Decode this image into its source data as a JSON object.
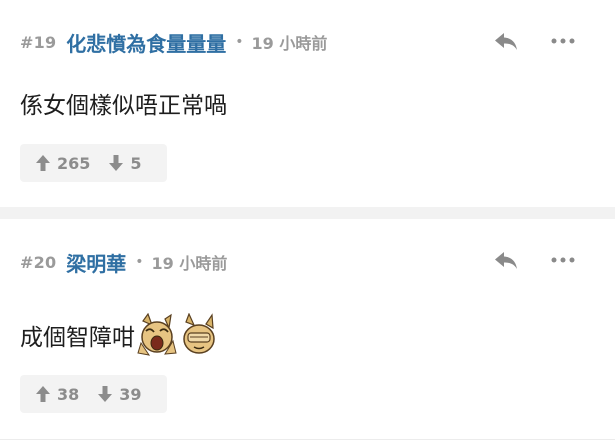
{
  "posts": [
    {
      "number": "#19",
      "username": "化悲憤為食量量量",
      "separator": "•",
      "time": "19 小時前",
      "content": "係女個樣似唔正常喎",
      "upvotes": "265",
      "downvotes": "5",
      "emojis": []
    },
    {
      "number": "#20",
      "username": "梁明華",
      "separator": "•",
      "time": "19 小時前",
      "content": "成個智障咁",
      "upvotes": "38",
      "downvotes": "39",
      "emojis": [
        "crying-dog-emoji",
        "facepalm-dog-emoji"
      ]
    }
  ],
  "colors": {
    "username": "#2f6fa3",
    "muted": "#9a9a9a",
    "vote_bg": "#f3f3f3",
    "divider": "#f2f2f2"
  },
  "icons": [
    "reply-icon",
    "more-icon",
    "arrow-up-icon",
    "arrow-down-icon"
  ]
}
